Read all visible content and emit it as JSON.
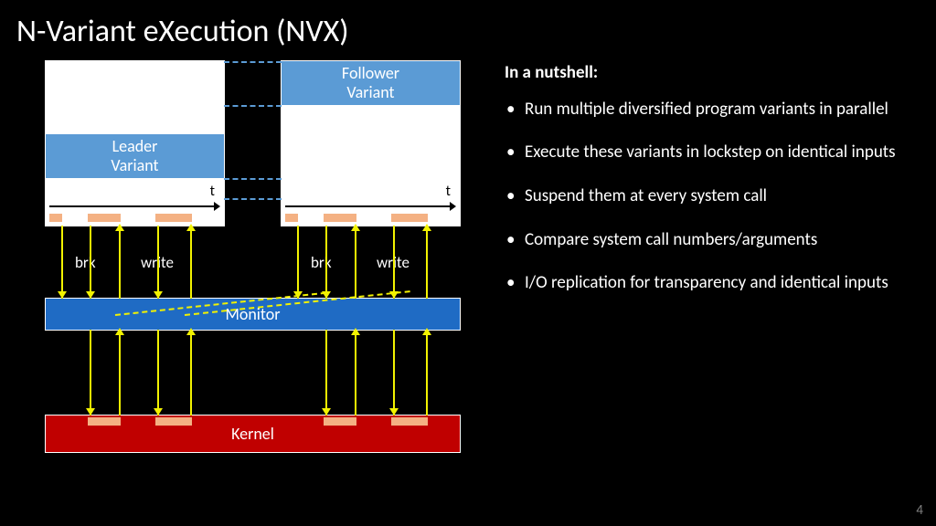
{
  "slide": {
    "title": "N-Variant eXecution (NVX)",
    "page_number": "4"
  },
  "diagram": {
    "leader_variant": "Leader\nVariant",
    "follower_variant": "Follower\nVariant",
    "monitor": "Monitor",
    "kernel": "Kernel",
    "time_axis": "t",
    "syscalls": {
      "left": [
        "brk",
        "write"
      ],
      "right": [
        "brk",
        "write"
      ]
    }
  },
  "text": {
    "heading": "In a nutshell:",
    "bullets": [
      "Run multiple diversified program variants in parallel",
      "Execute these variants in lockstep on identical inputs",
      "Suspend them at every system call",
      "Compare system call numbers/arguments",
      "I/O replication for transparency and identical inputs"
    ]
  },
  "colors": {
    "light_blue": "#5b9bd5",
    "monitor_blue": "#1f6bc4",
    "kernel_red": "#c00000",
    "segment_orange": "#f4b183",
    "arrow_yellow": "#f2f200"
  }
}
